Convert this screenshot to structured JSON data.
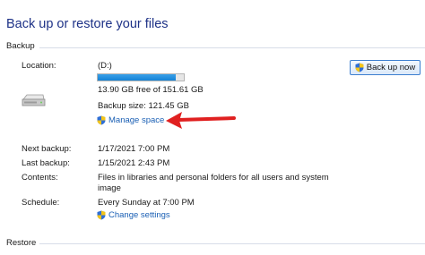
{
  "header": {
    "title": "Back up or restore your files"
  },
  "backup": {
    "section_title": "Backup",
    "location_label": "Location:",
    "location_value": "(D:)",
    "free_space": "13.90 GB free of 151.61 GB",
    "used_fraction": 0.908,
    "backup_size": "Backup size: 121.45 GB",
    "manage_space_link": "Manage space",
    "backup_now_button": "Back up now",
    "next_backup_label": "Next backup:",
    "next_backup_value": "1/17/2021 7:00 PM",
    "last_backup_label": "Last backup:",
    "last_backup_value": "1/15/2021 2:43 PM",
    "contents_label": "Contents:",
    "contents_line1": "Files in libraries and personal folders for all users and system",
    "contents_line2": "image",
    "schedule_label": "Schedule:",
    "schedule_value": "Every Sunday at 7:00 PM",
    "change_settings_link": "Change settings"
  },
  "restore": {
    "section_title": "Restore"
  },
  "icons": [
    "drive-icon",
    "uac-shield-icon",
    "red-arrow-annotation"
  ],
  "colors": {
    "title": "#1e3287",
    "link": "#1a5fb4",
    "bar": "#1583d6",
    "arrow": "#e02020"
  }
}
